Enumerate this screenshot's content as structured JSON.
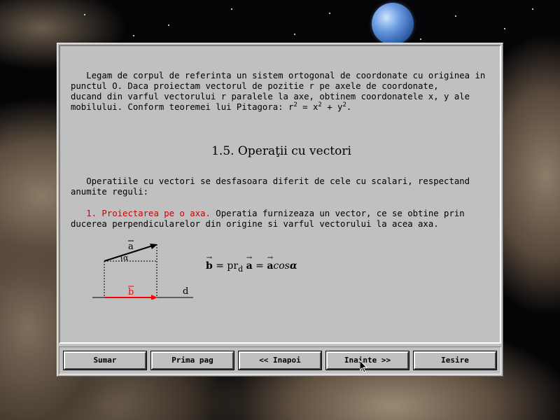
{
  "content": {
    "intro": {
      "line1": "   Legam de corpul de referinta un sistem ortogonal de coordonate cu originea in",
      "line2": "punctul O. Daca proiectam vectorul de pozitie r pe axele de coordonate,",
      "line3": "ducand din varful vectorului r paralele la axe, obtinem coordonatele x, y ale",
      "line4_prefix": "mobilului. Conform teoremei lui Pitagora: r",
      "line4_eq": " = x",
      "line4_plus": " + y",
      "line4_end": ".",
      "exponent": "2"
    },
    "heading": "1.5. Operaţii cu vectori",
    "operations": {
      "line1": "   Operatiile cu vectori se desfasoara diferit de cele cu scalari, respectand",
      "line2": "anumite reguli:"
    },
    "projection": {
      "title": "   1. Proiectarea pe o axa.",
      "line1_rest": " Operatia furnizeaza un vector, ce se obtine prin",
      "line2": "ducerea perpendicularelor din origine si varful vectorului la acea axa."
    },
    "diagram": {
      "label_a": "a",
      "label_alpha": "α",
      "label_b": "b",
      "label_d": "d",
      "colors": {
        "projection": "#ff0000",
        "vector": "#000000"
      }
    },
    "formula": {
      "b": "b",
      "eq1": " = pr",
      "sub": "d",
      "a1": "a",
      "eq2": " = ",
      "a2": "a",
      "cos": "cos",
      "alpha": "α"
    }
  },
  "buttons": {
    "sumar": "Sumar",
    "prima_pag": "Prima pag",
    "inapoi": "<< Inapoi",
    "inainte": "Inainte >>",
    "iesire": "Iesire"
  }
}
